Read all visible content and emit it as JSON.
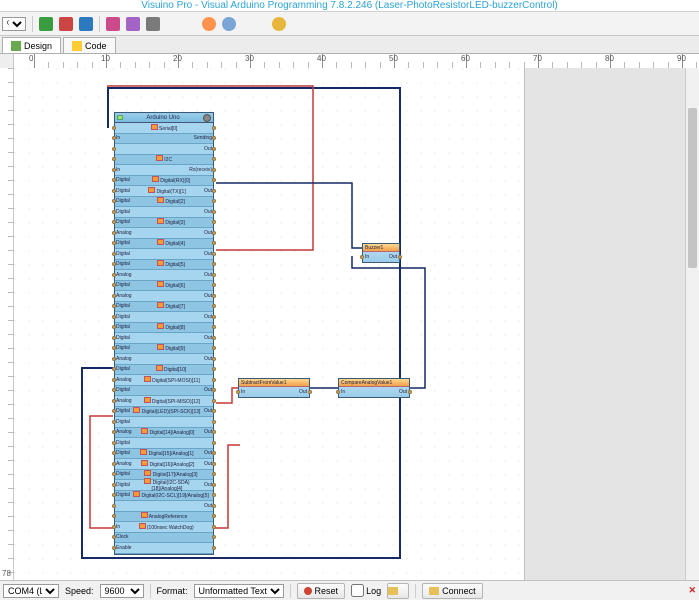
{
  "title": "Visuino Pro - Visual Arduino Programming 7.8.2.246 (Laser-PhotoResistorLED-buzzerControl)",
  "toolbar": {
    "zoom_pct": "%"
  },
  "tabs": {
    "design": "Design",
    "code": "Code"
  },
  "ruler": {
    "ticks": [
      0,
      10,
      20,
      30,
      40,
      50,
      60,
      70,
      80,
      90
    ]
  },
  "board": {
    "title": "Arduino Uno",
    "rows": [
      {
        "left": "",
        "mid": "Serial[0]",
        "right": ""
      },
      {
        "left": "In",
        "mid": "",
        "right": "Sending"
      },
      {
        "left": "",
        "mid": "",
        "right": "Out"
      },
      {
        "left": "",
        "mid": "I2C",
        "right": ""
      },
      {
        "left": "In",
        "mid": "",
        "right": "Rx(receiv)"
      },
      {
        "left": "Digital",
        "mid": "Digital(RX)[0]",
        "right": ""
      },
      {
        "left": "Digital",
        "mid": "Digital(TX)[1]",
        "right": "Out"
      },
      {
        "left": "Digital",
        "mid": "Digital[2]",
        "right": ""
      },
      {
        "left": "Digital",
        "mid": "",
        "right": "Out"
      },
      {
        "left": "Digital",
        "mid": "Digital[3]",
        "right": ""
      },
      {
        "left": "Analog",
        "mid": "",
        "right": "Out"
      },
      {
        "left": "Digital",
        "mid": "Digital[4]",
        "right": ""
      },
      {
        "left": "Digital",
        "mid": "",
        "right": "Out"
      },
      {
        "left": "Digital",
        "mid": "Digital[5]",
        "right": ""
      },
      {
        "left": "Analog",
        "mid": "",
        "right": "Out"
      },
      {
        "left": "Digital",
        "mid": "Digital[6]",
        "right": ""
      },
      {
        "left": "Analog",
        "mid": "",
        "right": "Out"
      },
      {
        "left": "Digital",
        "mid": "Digital[7]",
        "right": ""
      },
      {
        "left": "Digital",
        "mid": "",
        "right": "Out"
      },
      {
        "left": "Digital",
        "mid": "Digital[8]",
        "right": ""
      },
      {
        "left": "Digital",
        "mid": "",
        "right": "Out"
      },
      {
        "left": "Digital",
        "mid": "Digital[9]",
        "right": ""
      },
      {
        "left": "Analog",
        "mid": "",
        "right": "Out"
      },
      {
        "left": "Digital",
        "mid": "Digital[10]",
        "right": ""
      },
      {
        "left": "Analog",
        "mid": "Digital(SPI-MOSI)[11]",
        "right": ""
      },
      {
        "left": "Digital",
        "mid": "",
        "right": "Out"
      },
      {
        "left": "Analog",
        "mid": "Digital(SPI-MISO)[12]",
        "right": ""
      },
      {
        "left": "Digital",
        "mid": "Digital(LED)(SPI-SCK)[13]",
        "right": "Out"
      },
      {
        "left": "Digital",
        "mid": "",
        "right": ""
      },
      {
        "left": "Analog",
        "mid": "Digital[14]/Analog[0]",
        "right": "Out"
      },
      {
        "left": "Digital",
        "mid": "",
        "right": ""
      },
      {
        "left": "Digital",
        "mid": "Digital[15]/Analog[1]",
        "right": "Out"
      },
      {
        "left": "Analog",
        "mid": "Digital[16]/Analog[2]",
        "right": "Out"
      },
      {
        "left": "Digital",
        "mid": "Digital[17]/Analog[3]",
        "right": ""
      },
      {
        "left": "Digital",
        "mid": "Digital(I2C-SDA)[18]/Analog[4]",
        "right": "Out"
      },
      {
        "left": "Digital",
        "mid": "Digital(I2C-SCL)[19]/Analog[5]",
        "right": ""
      },
      {
        "left": "",
        "mid": "",
        "right": "Out"
      },
      {
        "left": "",
        "mid": "AnalogReference",
        "right": ""
      },
      {
        "left": "In",
        "mid": "(100nsec WatchDog)",
        "right": ""
      },
      {
        "left": "Clock",
        "mid": "",
        "right": ""
      },
      {
        "left": "Enable",
        "mid": "",
        "right": ""
      }
    ]
  },
  "comp_buzzer": {
    "title": "Buzzer1",
    "in": "In",
    "out": "Out"
  },
  "comp_sub": {
    "title": "SubtractFromValue1",
    "in": "In",
    "out": "Out"
  },
  "comp_cmp": {
    "title": "CompareAnalogValue1",
    "in": "In",
    "out": "Out"
  },
  "status": {
    "com": "COM4 (L",
    "speed_lbl": "Speed:",
    "speed_val": "9600",
    "format_lbl": "Format:",
    "format_val": "Unformatted Text",
    "reset": "Reset",
    "log": "Log",
    "log_btn": "",
    "connect": "Connect"
  },
  "coord": "78"
}
